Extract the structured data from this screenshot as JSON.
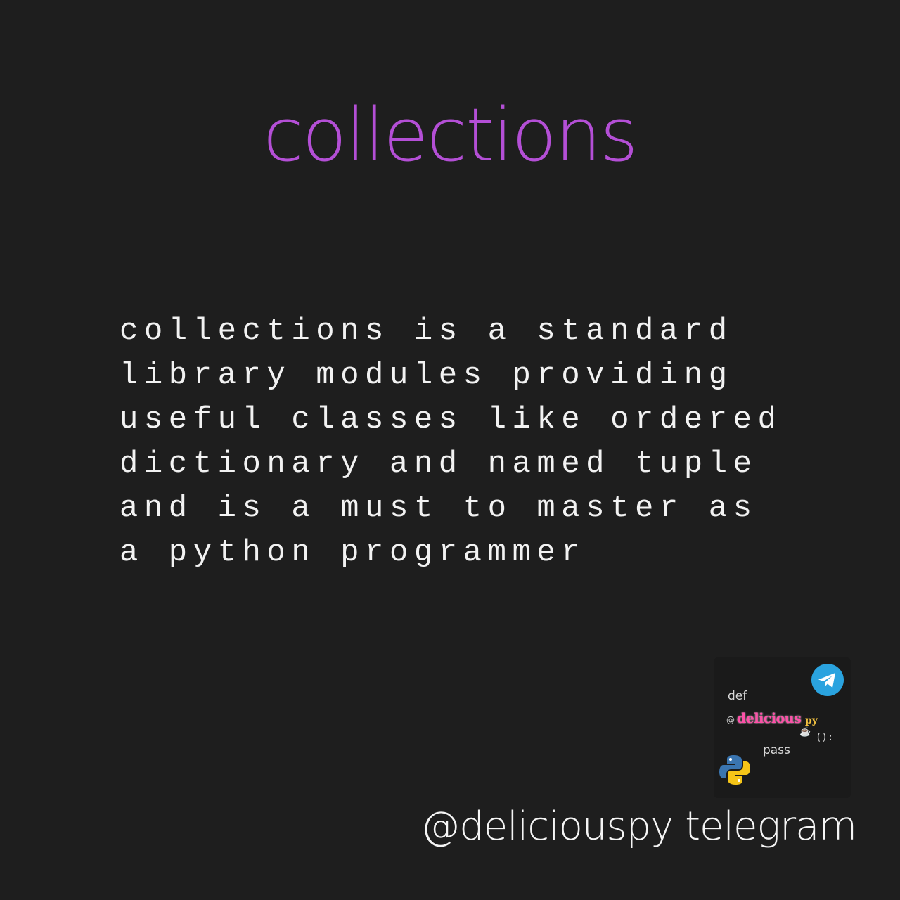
{
  "title": "collections",
  "body_lines": [
    "collections is a standard",
    "library modules providing",
    "useful classes like ordered",
    "dictionary and named tuple",
    "and is a must to master as",
    "a python programmer"
  ],
  "logo": {
    "def": "def",
    "at": "@",
    "brand": "delicious",
    "brand_suffix": "py",
    "parens": "():",
    "pass": "pass",
    "icons": [
      "telegram-icon",
      "python-icon",
      "coffee-cup-icon"
    ]
  },
  "footer": "@deliciouspy telegram",
  "colors": {
    "background": "#1e1e1e",
    "title": "#b44fd6",
    "text": "#f2f2f2",
    "brand": "#ff4fa8",
    "telegram": "#2aa3df"
  }
}
